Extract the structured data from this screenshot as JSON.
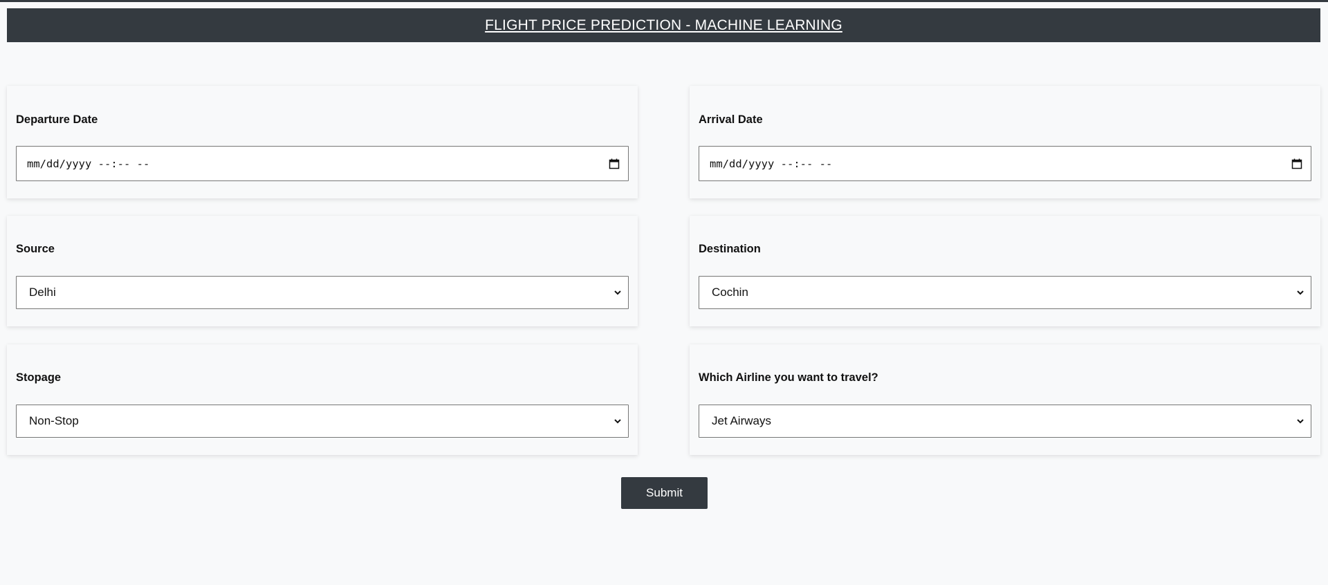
{
  "header": {
    "title": "FLIGHT PRICE PREDICTION - MACHINE LEARNING"
  },
  "form": {
    "departure_date": {
      "label": "Departure Date",
      "value": "mm/dd/yyyy --:-- --"
    },
    "arrival_date": {
      "label": "Arrival Date",
      "value": "mm/dd/yyyy --:-- --"
    },
    "source": {
      "label": "Source",
      "selected": "Delhi"
    },
    "destination": {
      "label": "Destination",
      "selected": "Cochin"
    },
    "stopage": {
      "label": "Stopage",
      "selected": "Non-Stop"
    },
    "airline": {
      "label": "Which Airline you want to travel?",
      "selected": "Jet Airways"
    },
    "submit_label": "Submit"
  },
  "icons": {
    "calendar": "calendar-icon",
    "chevron": "chevron-down-icon"
  },
  "colors": {
    "header_bg": "#343a40",
    "page_bg": "#f8f9fa",
    "button_bg": "#343a40"
  }
}
